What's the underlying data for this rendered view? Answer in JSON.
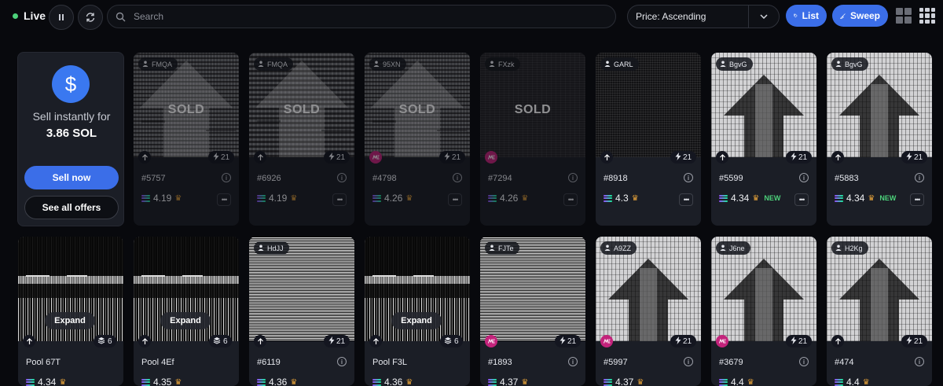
{
  "topbar": {
    "live_label": "Live",
    "search_placeholder": "Search",
    "sort_label": "Price: Ascending",
    "list_label": "List",
    "sweep_label": "Sweep"
  },
  "sell_panel": {
    "text": "Sell instantly for",
    "price": "3.86 SOL",
    "sell_now": "Sell now",
    "see_all_offers": "See all offers"
  },
  "cards": [
    {
      "owner": "FMQA",
      "name": "#5757",
      "price": "4.19",
      "sold": true,
      "sold_label": "SOLD",
      "count": "21",
      "art": "gray",
      "logo": "plain"
    },
    {
      "owner": "FMQA",
      "name": "#6926",
      "price": "4.19",
      "sold": true,
      "sold_label": "SOLD",
      "count": "21",
      "art": "gray2",
      "logo": "plain"
    },
    {
      "owner": "95XN",
      "name": "#4798",
      "price": "4.26",
      "sold": true,
      "sold_label": "SOLD",
      "count": "21",
      "art": "gray",
      "logo": "me"
    },
    {
      "owner": "FXzk",
      "name": "#7294",
      "price": "4.26",
      "sold": true,
      "sold_label": "SOLD",
      "count": "",
      "art": "dark",
      "logo": "me"
    },
    {
      "owner": "GARL",
      "name": "#8918",
      "price": "4.3",
      "sold": false,
      "count": "21",
      "art": "black",
      "logo": "plain"
    },
    {
      "owner": "BgvG",
      "name": "#5599",
      "price": "4.34",
      "sold": false,
      "new_label": "NEW",
      "count": "21",
      "art": "light",
      "logo": "plain"
    },
    {
      "owner": "BgvG",
      "name": "#5883",
      "price": "4.34",
      "sold": false,
      "new_label": "NEW",
      "count": "21",
      "art": "light",
      "logo": "plain"
    },
    {
      "pool": true,
      "name": "Pool 67T",
      "price": "4.34",
      "expand_label": "Expand",
      "count": "6",
      "art": "stripes",
      "logo": "plain"
    },
    {
      "pool": true,
      "name": "Pool 4Ef",
      "price": "4.35",
      "expand_label": "Expand",
      "count": "6",
      "art": "stripes",
      "logo": "plain"
    },
    {
      "owner": "HdJJ",
      "name": "#6119",
      "price": "4.36",
      "count": "21",
      "art": "noise",
      "logo": "plain"
    },
    {
      "pool": true,
      "name": "Pool F3L",
      "price": "4.36",
      "expand_label": "Expand",
      "count": "6",
      "art": "stripes",
      "logo": "plain"
    },
    {
      "owner": "FJTe",
      "name": "#1893",
      "price": "4.37",
      "count": "21",
      "art": "noise",
      "logo": "me"
    },
    {
      "owner": "A9ZZ",
      "name": "#5997",
      "price": "4.37",
      "count": "21",
      "art": "light",
      "logo": "me"
    },
    {
      "owner": "J6ne",
      "name": "#3679",
      "price": "4.4",
      "count": "21",
      "art": "light",
      "logo": "me"
    },
    {
      "owner": "H2Kg",
      "name": "#474",
      "price": "4.4",
      "count": "21",
      "art": "light",
      "logo": "plain"
    }
  ],
  "colors": {
    "accent": "#3b6ee8",
    "live": "#4cd17a",
    "new": "#4cd17a",
    "crown": "#e5a23a",
    "magic_eden": "#c3237b"
  },
  "icons": {
    "pause": "pause-icon",
    "refresh": "refresh-icon",
    "search": "search-icon",
    "sort": "chevron-down-icon",
    "list": "tag-icon",
    "sweep": "broom-icon",
    "owner": "user-icon",
    "bolt": "bolt-icon",
    "info": "info-icon",
    "more": "more-icon",
    "layers": "layers-icon",
    "solana": "solana-icon",
    "crown": "crown-icon"
  }
}
